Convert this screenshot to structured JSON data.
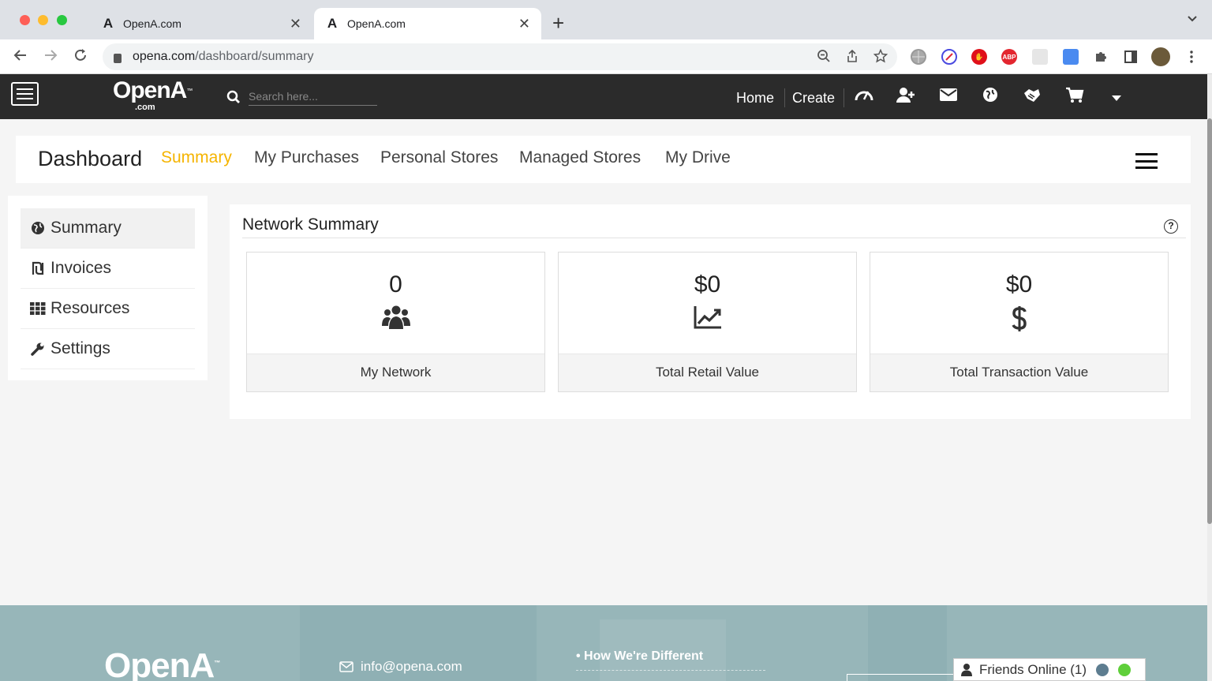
{
  "browser": {
    "tabs": [
      {
        "title": "OpenA.com",
        "favicon": "A"
      },
      {
        "title": "OpenA.com",
        "favicon": "A"
      }
    ],
    "new_tab": "+",
    "url_host": "opena.com",
    "url_path": "/dashboard/summary",
    "extensions": [
      "globe-ext-icon",
      "block-ext-icon",
      "stop-ext-icon",
      "adblock-ext-icon",
      "grey-ext-icon",
      "translate-ext-icon",
      "puzzle-icon",
      "sidepanel-icon",
      "profile-avatar"
    ],
    "adblock_label": "ABP"
  },
  "header": {
    "logo_main": "OpenA",
    "logo_tm": "™",
    "logo_sub": ".com",
    "search_placeholder": "Search here...",
    "nav": {
      "home": "Home",
      "create": "Create"
    },
    "icons": [
      "speedometer-icon",
      "add-user-icon",
      "envelope-icon",
      "globe-icon",
      "handshake-icon",
      "cart-icon",
      "caret-down-icon"
    ]
  },
  "dashnav": {
    "title": "Dashboard",
    "tabs": [
      "Summary",
      "My Purchases",
      "Personal Stores",
      "Managed Stores",
      "My Drive"
    ],
    "active_tab": "Summary"
  },
  "sidebar": {
    "items": [
      {
        "label": "Summary",
        "icon": "globe-icon"
      },
      {
        "label": "Invoices",
        "icon": "shekel-icon"
      },
      {
        "label": "Resources",
        "icon": "grid-icon"
      },
      {
        "label": "Settings",
        "icon": "wrench-icon"
      }
    ]
  },
  "panel": {
    "title": "Network Summary",
    "help": "?",
    "cards": [
      {
        "value": "0",
        "label": "My Network",
        "icon": "users-icon"
      },
      {
        "value": "$0",
        "label": "Total Retail Value",
        "icon": "line-chart-icon"
      },
      {
        "value": "$0",
        "label": "Total Transaction Value",
        "icon": "dollar-icon"
      }
    ]
  },
  "footer": {
    "logo": "OpenA",
    "logo_tm": "™",
    "email": "info@opena.com",
    "link": "How We're Different",
    "friends_online": "Friends Online (1)"
  },
  "colors": {
    "accent": "#f5b400",
    "header_bg": "#2b2b2b",
    "footer_bg": "#8fb0b4"
  }
}
